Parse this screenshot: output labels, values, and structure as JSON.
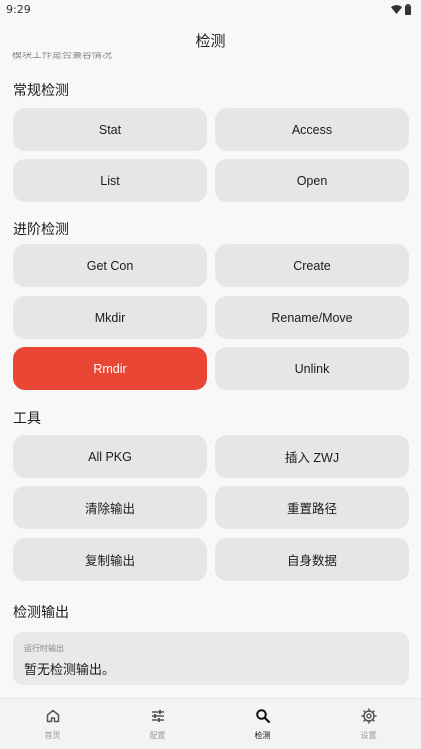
{
  "status": {
    "time": "9:29"
  },
  "header": {
    "title": "检测"
  },
  "clipped_text": "模块工作是否兼容情况",
  "sections": {
    "regular": "常规检测",
    "advanced": "进阶检测",
    "tools": "工具",
    "output": "检测输出"
  },
  "buttons": {
    "stat": "Stat",
    "access": "Access",
    "list": "List",
    "open": "Open",
    "get_con": "Get Con",
    "create": "Create",
    "mkdir": "Mkdir",
    "rename_move": "Rename/Move",
    "rmdir": "Rmdir",
    "unlink": "Unlink",
    "all_pkg": "All PKG",
    "insert_zwj": "插入 ZWJ",
    "clear_output": "清除输出",
    "reset_path": "重置路径",
    "copy_output": "复制输出",
    "self_data": "自身数据"
  },
  "output": {
    "label": "运行时输出",
    "text": "暂无检测输出。"
  },
  "nav": {
    "home": "首页",
    "config": "配置",
    "detect": "检测",
    "settings": "设置"
  },
  "colors": {
    "accent_danger": "#ea4636",
    "button_bg": "#e6e6e6",
    "background": "#f8f8f8"
  }
}
